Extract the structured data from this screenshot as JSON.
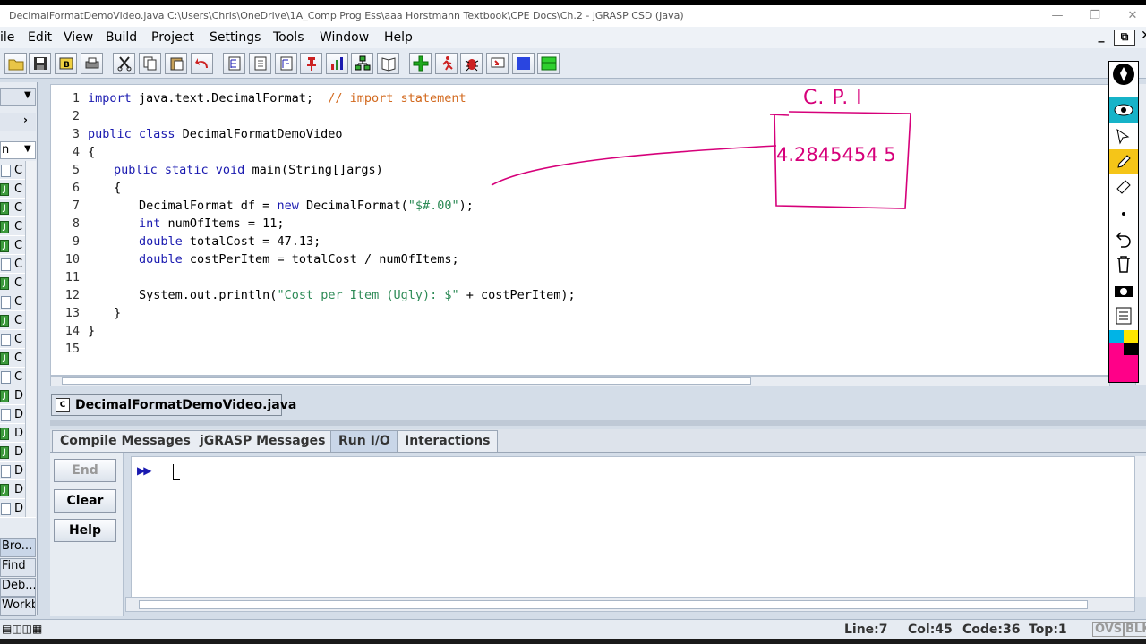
{
  "window": {
    "title": "DecimalFormatDemoVideo.java  C:\\Users\\Chris\\OneDrive\\1A_Comp Prog Ess\\aaa Horstmann Textbook\\CPE Docs\\Ch.2 - jGRASP CSD (Java)",
    "minimize": "—",
    "restore": "❐",
    "close": "✕"
  },
  "menu": {
    "file": "ile",
    "edit": "Edit",
    "view": "View",
    "build": "Build",
    "project": "Project",
    "settings": "Settings",
    "tools": "Tools",
    "window": "Window",
    "help": "Help"
  },
  "mdi": {
    "minimize": "_",
    "restore": "⧉",
    "close": "✕"
  },
  "left_panel": {
    "letters": [
      "C",
      "C",
      "C",
      "C",
      "C",
      "C",
      "C",
      "C",
      "C",
      "C",
      "C",
      "C",
      "D",
      "D",
      "D",
      "D",
      "D",
      "D",
      "D"
    ],
    "tab_n": "n",
    "buttons": [
      "Bro...",
      "Find",
      "Deb...",
      "Workb"
    ]
  },
  "editor": {
    "lines": [
      {
        "n": "1"
      },
      {
        "n": "2"
      },
      {
        "n": "3"
      },
      {
        "n": "4"
      },
      {
        "n": "5"
      },
      {
        "n": "6"
      },
      {
        "n": "7"
      },
      {
        "n": "8"
      },
      {
        "n": "9"
      },
      {
        "n": "10"
      },
      {
        "n": "11"
      },
      {
        "n": "12"
      },
      {
        "n": "13"
      },
      {
        "n": "14"
      },
      {
        "n": "15"
      }
    ],
    "code": {
      "l1_kw": "import",
      "l1_rest": " java.text.DecimalFormat;  ",
      "l1_cmt": "// import statement",
      "l3_kw": "public class",
      "l3_rest": " DecimalFormatDemoVideo",
      "l4": "{",
      "l5_kw": "public static void",
      "l5_rest": " main(String[]args)",
      "l6": "{",
      "l7_a": "DecimalFormat df = ",
      "l7_kw": "new",
      "l7_b": " DecimalFormat(",
      "l7_str": "\"$#.00\"",
      "l7_c": ");",
      "l8_kw": "int",
      "l8_rest": " numOfItems = 11;",
      "l9_kw": "double",
      "l9_rest": " totalCost = 47.13;",
      "l10_kw": "double",
      "l10_rest": " costPerItem = totalCost / numOfItems;",
      "l12_a": "System.out.println(",
      "l12_str": "\"Cost per Item (Ugly): $\"",
      "l12_b": " + costPerItem);",
      "l13": "}",
      "l14": "}"
    }
  },
  "annotation": {
    "heading": "C. P. I",
    "value": "4.2845454 5"
  },
  "file_tab": "DecimalFormatDemoVideo.java",
  "message_tabs": [
    "Compile Messages",
    "jGRASP Messages",
    "Run I/O",
    "Interactions"
  ],
  "active_message_tab": "Run I/O",
  "run_buttons": {
    "end": "End",
    "clear": "Clear",
    "help": "Help"
  },
  "console": {
    "prompt": "▶▶"
  },
  "status": {
    "line": "Line:7",
    "col": "Col:45",
    "code": "Code:36",
    "top": "Top:1",
    "ovs": "OVS",
    "blk": "BLK"
  },
  "colors": {
    "keyword": "#1a1ab0",
    "string": "#2e8b57",
    "comment": "#d2691e",
    "annotation": "#d6007a"
  }
}
